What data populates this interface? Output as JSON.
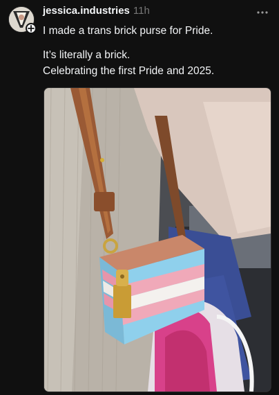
{
  "post": {
    "author": {
      "username": "jessica.industries",
      "timestamp": "11h",
      "avatar_icon": "profile-photo",
      "follow_icon": "plus-icon"
    },
    "more_icon": "ellipsis-icon",
    "caption_lines": [
      "I made a trans brick purse for Pride.",
      "It’s literally a brick.",
      "Celebrating the first Pride and 2025."
    ],
    "media": {
      "kind": "photo",
      "flag_colors": [
        "#8fd0ec",
        "#f0a9b9",
        "#f4f1ee",
        "#f0a9b9",
        "#8fd0ec"
      ]
    }
  },
  "colors": {
    "background": "#101010",
    "text_primary": "#f3f5f7",
    "text_secondary": "#777777"
  }
}
